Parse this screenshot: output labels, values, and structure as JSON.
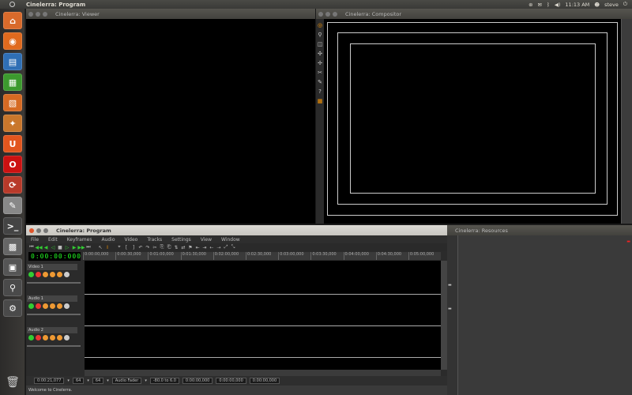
{
  "top_panel": {
    "title": "Cinelerra: Program",
    "time": "11:13 AM",
    "user": "steve"
  },
  "launcher": {
    "items": [
      {
        "name": "home-folder-icon",
        "glyph": "⌂",
        "color": "#d96a2b"
      },
      {
        "name": "firefox-icon",
        "glyph": "◉",
        "color": "#e06a1e"
      },
      {
        "name": "writer-icon",
        "glyph": "▤",
        "color": "#2f6fb5"
      },
      {
        "name": "calc-icon",
        "glyph": "▦",
        "color": "#3c9a2e"
      },
      {
        "name": "impress-icon",
        "glyph": "▧",
        "color": "#d66a23"
      },
      {
        "name": "software-center-icon",
        "glyph": "✦",
        "color": "#c9772c"
      },
      {
        "name": "ubuntu-one-icon",
        "glyph": "U",
        "color": "#e2561e"
      },
      {
        "name": "opera-icon",
        "glyph": "O",
        "color": "#cc1111"
      },
      {
        "name": "update-manager-icon",
        "glyph": "⟳",
        "color": "#b83a2a"
      },
      {
        "name": "text-editor-icon",
        "glyph": "✎",
        "color": "#888888"
      },
      {
        "name": "terminal-icon",
        "glyph": ">_",
        "color": "#444444"
      },
      {
        "name": "cinelerra-icon",
        "glyph": "▩",
        "color": "#666666"
      },
      {
        "name": "workspace-switcher-icon",
        "glyph": "▣",
        "color": "#555555"
      },
      {
        "name": "search-icon",
        "glyph": "⚲",
        "color": "#4a4a4a"
      },
      {
        "name": "settings-icon",
        "glyph": "⚙",
        "color": "#4a4a4a"
      }
    ]
  },
  "viewer": {
    "title": "Cinelerra: Viewer"
  },
  "compositor": {
    "title": "Cinelerra: Compositor"
  },
  "resources": {
    "title": "Cinelerra: Resources"
  },
  "program": {
    "title": "Cinelerra: Program",
    "menu": [
      "File",
      "Edit",
      "Keyframes",
      "Audio",
      "Video",
      "Tracks",
      "Settings",
      "View",
      "Window"
    ],
    "clock": "0:00:00:000",
    "ruler_ticks": [
      "0:00:00,000",
      "0:00:30,000",
      "0:01:00,000",
      "0:01:30,000",
      "0:02:00,000",
      "0:02:30,000",
      "0:03:00,000",
      "0:03:30,000",
      "0:04:00,000",
      "0:04:30,000",
      "0:05:00,000"
    ],
    "tracks": [
      "Video 1",
      "Audio 1",
      "Audio 2"
    ],
    "bottom": {
      "position": "0:00:21,077",
      "zoom_a": "64",
      "zoom_b": "64",
      "automation": "Audio Fader",
      "range": "-80.0 to 6.0",
      "sel_start": "0:00:00,000",
      "sel_end": "0:00:00,000",
      "sel_len": "0:00:00,000"
    },
    "status": "Welcome to Cinelerra."
  }
}
